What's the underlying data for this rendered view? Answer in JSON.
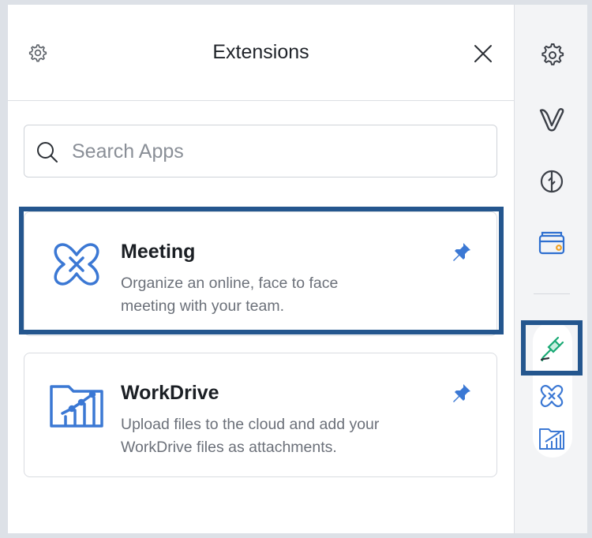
{
  "header": {
    "title": "Extensions",
    "settings_icon": "gear-icon",
    "close_icon": "close-icon"
  },
  "search": {
    "placeholder": "Search Apps",
    "value": ""
  },
  "apps": [
    {
      "name": "Meeting",
      "description_line1": "Organize an online, face to face",
      "description_line2": "meeting with your team.",
      "icon": "meeting-icon",
      "pinned": true,
      "highlighted": true
    },
    {
      "name": "WorkDrive",
      "description_line1": "Upload files to the cloud and add your",
      "description_line2": "WorkDrive files as attachments.",
      "icon": "workdrive-icon",
      "pinned": true,
      "highlighted": false
    }
  ],
  "rail": {
    "items": [
      "settings-icon",
      "vani-icon",
      "insights-icon",
      "wallet-icon"
    ],
    "pinned_items": [
      "extensions-plug-icon",
      "meeting-icon",
      "workdrive-icon"
    ],
    "active_item": "extensions-plug-icon"
  },
  "colors": {
    "accent_blue": "#3b78d4",
    "highlight_border": "#24568e",
    "plug_green": "#19a974",
    "icon_gray": "#3c4048"
  }
}
